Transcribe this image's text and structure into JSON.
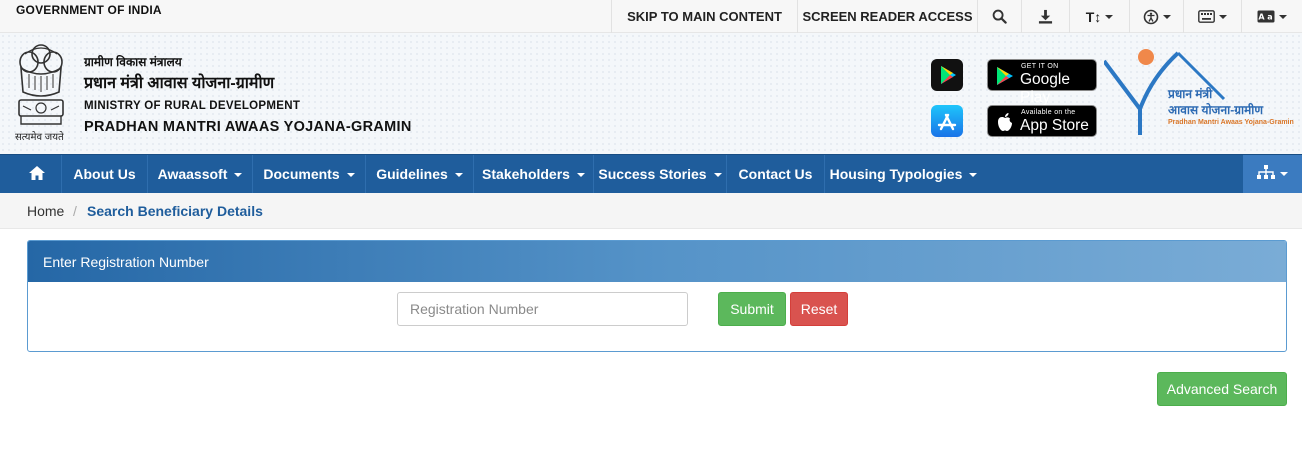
{
  "topbar": {
    "government": "GOVERNMENT OF INDIA",
    "skip_link": "SKIP TO MAIN CONTENT",
    "screen_reader": "SCREEN READER ACCESS",
    "text_size_label": "T↕",
    "icons": [
      "search-icon",
      "download-icon",
      "text-size-icon",
      "accessibility-icon",
      "keyboard-icon",
      "language-icon"
    ]
  },
  "header": {
    "emblem_caption": "सत्यमेव जयते",
    "ministry_hindi": "ग्रामीण विकास मंत्रालय",
    "scheme_hindi": "प्रधान मंत्री आवास योजना-ग्रामीण",
    "ministry_english": "MINISTRY OF RURAL DEVELOPMENT",
    "scheme_english": "PRADHAN MANTRI AWAAS YOJANA-GRAMIN",
    "google_play_small": "GET IT ON",
    "google_play_big": "Google Play",
    "app_store_small": "Available on the",
    "app_store_big": "App Store",
    "logo_line1": "प्रधान मंत्री",
    "logo_line2": "आवास योजना-ग्रामीण",
    "logo_line3": "Pradhan Mantri Awaas Yojana-Gramin"
  },
  "nav": {
    "items": [
      {
        "label": "About Us",
        "dropdown": false
      },
      {
        "label": "Awaassoft",
        "dropdown": true
      },
      {
        "label": "Documents",
        "dropdown": true
      },
      {
        "label": "Guidelines",
        "dropdown": true
      },
      {
        "label": "Stakeholders",
        "dropdown": true
      },
      {
        "label": "Success Stories",
        "dropdown": true
      },
      {
        "label": "Contact Us",
        "dropdown": false
      },
      {
        "label": "Housing Typologies",
        "dropdown": true
      }
    ]
  },
  "breadcrumb": {
    "home": "Home",
    "separator": "/",
    "current": "Search Beneficiary Details"
  },
  "form": {
    "panel_title": "Enter Registration Number",
    "input_placeholder": "Registration Number",
    "input_value": "",
    "submit_label": "Submit",
    "reset_label": "Reset",
    "advanced_label": "Advanced Search"
  },
  "colors": {
    "nav_blue": "#1f5d9c",
    "submit_green": "#5cb85c",
    "reset_red": "#d9534f",
    "logo_orange": "#f0884a"
  }
}
